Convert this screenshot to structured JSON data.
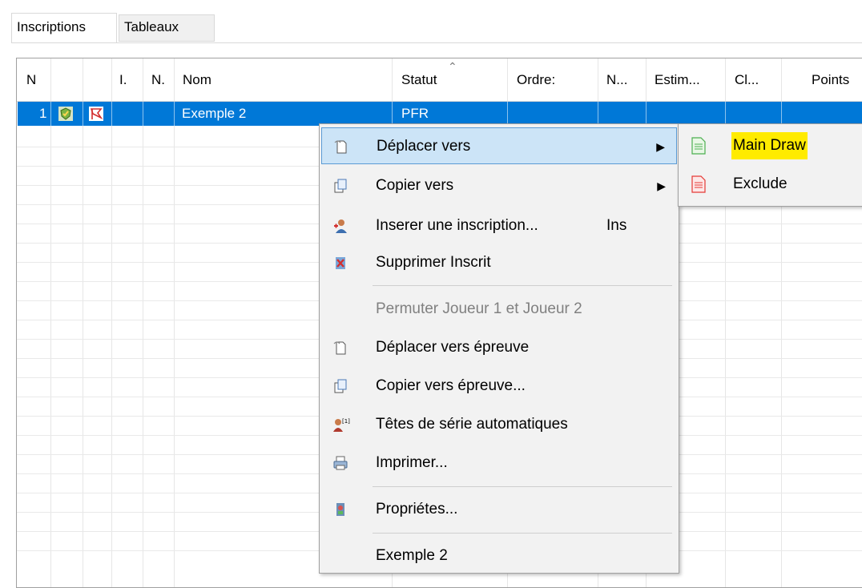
{
  "tabs": [
    {
      "label": "Inscriptions",
      "active": true
    },
    {
      "label": "Tableaux",
      "active": false
    }
  ],
  "grid": {
    "headers": [
      "N",
      "I.",
      "N.",
      "Nom",
      "Statut",
      "Ordre:",
      "N...",
      "Estim...",
      "Cl...",
      "Points"
    ],
    "selected_row": {
      "number": "1",
      "name": "Exemple 2",
      "status": "PFR"
    },
    "sort_column": "Statut"
  },
  "context_menu": {
    "items": [
      {
        "label": "Déplacer vers",
        "icon": "move-document-icon",
        "has_submenu": true,
        "highlighted": true
      },
      {
        "label": "Copier vers",
        "icon": "copy-document-icon",
        "has_submenu": true
      },
      {
        "label": "Inserer une inscription...",
        "shortcut": "Ins",
        "icon": "insert-user-icon"
      },
      {
        "label": "Supprimer Inscrit",
        "icon": "delete-user-icon"
      },
      {
        "label": "Permuter Joueur 1 et Joueur 2",
        "disabled": true
      },
      {
        "label": "Déplacer vers épreuve",
        "icon": "move-document-icon"
      },
      {
        "label": "Copier vers épreuve...",
        "icon": "copy-document-icon"
      },
      {
        "label": "Têtes de série automatiques",
        "icon": "seed-user-icon",
        "icon_text": "[1]"
      },
      {
        "label": "Imprimer...",
        "icon": "printer-icon"
      },
      {
        "label": "Propriétes...",
        "icon": "properties-icon"
      },
      {
        "label": "Exemple 2"
      }
    ]
  },
  "submenu": {
    "items": [
      {
        "label": "Main Draw",
        "icon": "green-document-icon",
        "highlight_color": "#ffeb00"
      },
      {
        "label": "Exclude",
        "icon": "red-document-icon"
      }
    ]
  },
  "colors": {
    "selection": "#0078d7",
    "menu_hover": "#cce4f7",
    "highlight": "#ffeb00"
  }
}
